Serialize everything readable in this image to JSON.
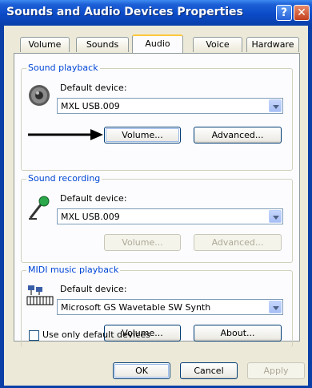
{
  "window": {
    "title": "Sounds and Audio Devices Properties",
    "help_glyph": "?",
    "close_glyph": "✕"
  },
  "tabs": [
    {
      "label": "Volume"
    },
    {
      "label": "Sounds"
    },
    {
      "label": "Audio"
    },
    {
      "label": "Voice"
    },
    {
      "label": "Hardware"
    }
  ],
  "active_tab": "Audio",
  "playback": {
    "group_label": "Sound playback",
    "device_label": "Default device:",
    "device_value": "MXL USB.009",
    "volume_button": "Volume...",
    "advanced_button": "Advanced..."
  },
  "recording": {
    "group_label": "Sound recording",
    "device_label": "Default device:",
    "device_value": "MXL USB.009",
    "volume_button": "Volume...",
    "advanced_button": "Advanced..."
  },
  "midi": {
    "group_label": "MIDI music playback",
    "device_label": "Default device:",
    "device_value": "Microsoft GS Wavetable SW Synth",
    "volume_button": "Volume...",
    "about_button": "About..."
  },
  "use_default_only_label": "Use only default devices",
  "footer": {
    "ok": "OK",
    "cancel": "Cancel",
    "apply": "Apply"
  }
}
